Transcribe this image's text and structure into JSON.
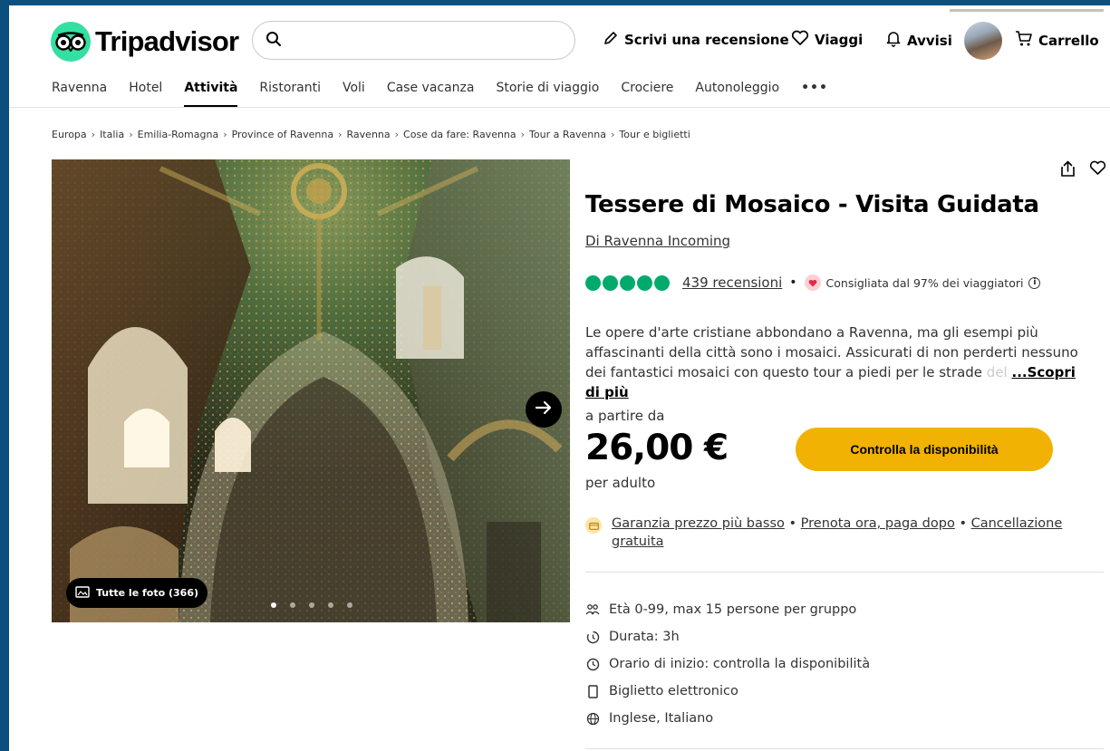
{
  "header": {
    "brand": "Tripadvisor",
    "search_placeholder": "",
    "write_review": "Scrivi una recensione",
    "trips": "Viaggi",
    "alerts": "Avvisi",
    "cart": "Carrello",
    "icons": [
      "search-icon",
      "pencil-icon",
      "heart-icon",
      "bell-icon",
      "cart-icon"
    ]
  },
  "nav": {
    "items": [
      "Ravenna",
      "Hotel",
      "Attività",
      "Ristoranti",
      "Voli",
      "Case vacanza",
      "Storie di viaggio",
      "Crociere",
      "Autonoleggio"
    ],
    "active": "Attività",
    "more": "•••"
  },
  "breadcrumb": [
    "Europa",
    "Italia",
    "Emilia-Romagna",
    "Province of Ravenna",
    "Ravenna",
    "Cose da fare: Ravenna",
    "Tour a Ravenna",
    "Tour e biglietti"
  ],
  "gallery": {
    "all_photos": "Tutte le foto (366)",
    "dots": 5,
    "active_dot": 0
  },
  "product": {
    "title": "Tessere di Mosaico - Visita Guidata",
    "provider": "Di Ravenna Incoming",
    "rating_bubbles": 5,
    "reviews": "439 recensioni",
    "recommended": "Consigliata dal 97% dei viaggiatori",
    "description": "Le opere d'arte cristiane abbondano a Ravenna, ma gli esempi più affascinanti della città sono i mosaici. Assicurati di non perderti nessuno dei fantastici mosaici con questo tour a piedi per le strade ",
    "description_fade": "del",
    "read_more": "...Scopri di più",
    "price_from": "a partire da",
    "price": "26,00 €",
    "price_per": "per adulto",
    "cta": "Controlla la disponibilità",
    "guarantee": {
      "lowest_price": "Garanzia prezzo più basso",
      "book_now": "Prenota ora, paga dopo",
      "cancellation": "Cancellazione gratuita"
    },
    "details": [
      {
        "icon": "group-icon",
        "text": "Età 0-99, max 15 persone per gruppo"
      },
      {
        "icon": "timer-icon",
        "text": "Durata: 3h"
      },
      {
        "icon": "clock-icon",
        "text": "Orario di inizio: controlla la disponibilità"
      },
      {
        "icon": "mobile-ticket-icon",
        "text": "Biglietto elettronico"
      },
      {
        "icon": "language-icon",
        "text": "Inglese, Italiano"
      }
    ]
  },
  "colors": {
    "brand_green": "#34e0a1",
    "rating_green": "#00aa6c",
    "cta_yellow": "#f2b203",
    "frame_blue": "#0b4f7f"
  }
}
